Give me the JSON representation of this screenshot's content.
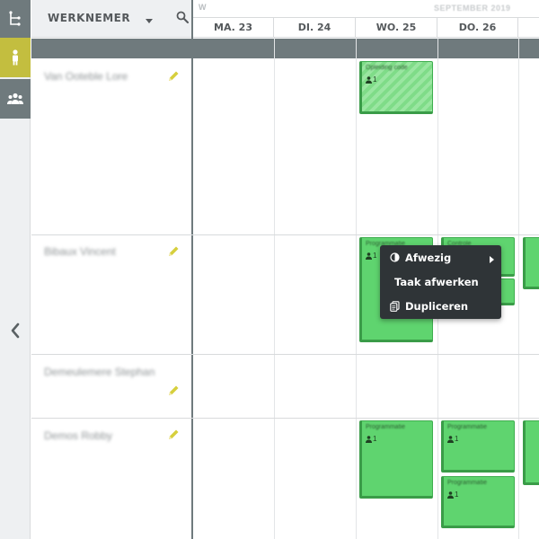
{
  "sidebar": {
    "icons": [
      "org-tree-icon",
      "person-icon",
      "group-icon"
    ],
    "collapse_icon": "chevron-left-icon"
  },
  "employee_panel": {
    "title": "WERKNEMER"
  },
  "calendar": {
    "week_label": "W",
    "month_label": "SEPTEMBER 2019",
    "days": [
      "MA. 23",
      "DI. 24",
      "WO. 25",
      "DO. 26"
    ]
  },
  "employees": [
    {
      "name": "Van Ooteble Lore"
    },
    {
      "name": "Bibaux Vincent"
    },
    {
      "name": "Demeulemere Stephan"
    },
    {
      "name": "Demos Robby"
    }
  ],
  "tasks": [
    {
      "title": "Opleiding code",
      "count": "1"
    },
    {
      "title": "Programmatie",
      "count": "1"
    },
    {
      "title": "Controle",
      "count": ""
    },
    {
      "title": "Programmatie",
      "count": "1"
    },
    {
      "title": "Programmatie",
      "count": "1"
    },
    {
      "title": "Programmatie",
      "count": "1"
    }
  ],
  "context_menu": {
    "items": [
      {
        "label": "Afwezig",
        "icon": "half-circle-icon",
        "has_submenu": true
      },
      {
        "label": "Taak afwerken",
        "icon": "",
        "has_submenu": false
      },
      {
        "label": "Dupliceren",
        "icon": "copy-icon",
        "has_submenu": false
      }
    ]
  },
  "colors": {
    "rail_grey": "#6f7a7d",
    "rail_active": "#c3be3f",
    "task_green": "#5fd46f",
    "menu_bg": "#2f3437"
  }
}
